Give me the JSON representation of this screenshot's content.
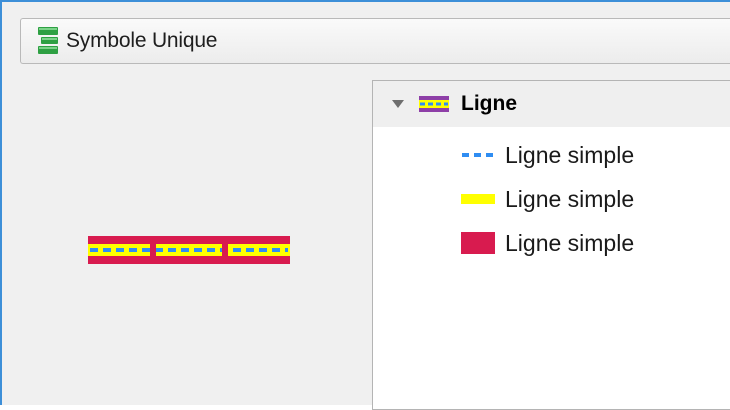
{
  "renderer": {
    "label": "Symbole Unique",
    "icon": "single-symbol-renderer-icon"
  },
  "preview": {
    "icon": "line-symbol-preview"
  },
  "symbol_tree": {
    "root": {
      "label": "Ligne",
      "expanded": true,
      "icon": "layered-line-icon"
    },
    "layers": [
      {
        "label": "Ligne simple",
        "icon": "dashed-line-icon",
        "color": "#2f8df2"
      },
      {
        "label": "Ligne simple",
        "icon": "yellow-line-icon",
        "color": "#ffff00"
      },
      {
        "label": "Ligne simple",
        "icon": "crimson-line-icon",
        "color": "#d81b4f"
      }
    ]
  },
  "colors": {
    "accent_frame": "#3d8fd8",
    "crimson": "#d81b4f",
    "yellow": "#ffff00",
    "blue": "#2f8df2",
    "renderer_green": "#2ea043"
  }
}
